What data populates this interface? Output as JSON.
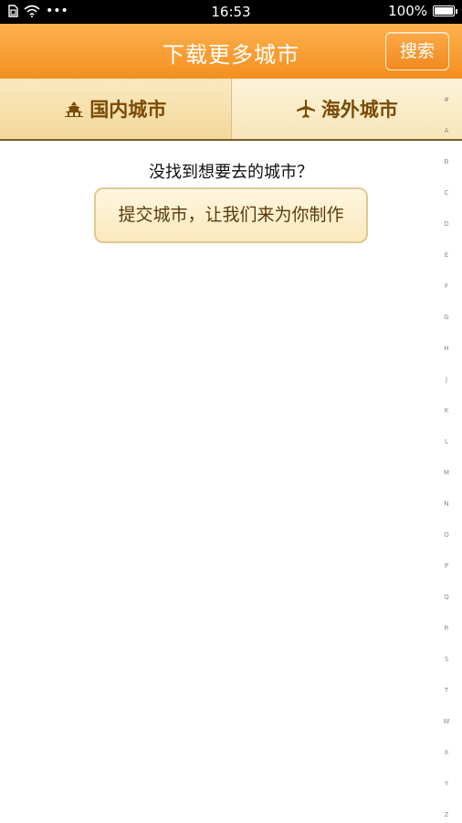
{
  "status_bar": {
    "time": "16:53",
    "battery_text": "100%",
    "battery_level": 1.0,
    "more_indicator": "•••"
  },
  "header": {
    "title": "下载更多城市",
    "search_label": "搜索"
  },
  "tabs": [
    {
      "label": "国内城市",
      "icon": "pagoda-icon"
    },
    {
      "label": "海外城市",
      "icon": "airplane-icon"
    }
  ],
  "empty_state": {
    "prompt": "没找到想要去的城市？",
    "submit_label": "提交城市，让我们来为你制作"
  },
  "index_bar": {
    "letters": [
      "#",
      "A",
      "B",
      "C",
      "D",
      "E",
      "F",
      "G",
      "H",
      "J",
      "K",
      "L",
      "M",
      "N",
      "O",
      "P",
      "Q",
      "R",
      "S",
      "T",
      "W",
      "X",
      "Y",
      "Z"
    ]
  },
  "colors": {
    "header_top": "#fdb14f",
    "header_bottom": "#f48f1f",
    "tab_text": "#7a4a06"
  }
}
